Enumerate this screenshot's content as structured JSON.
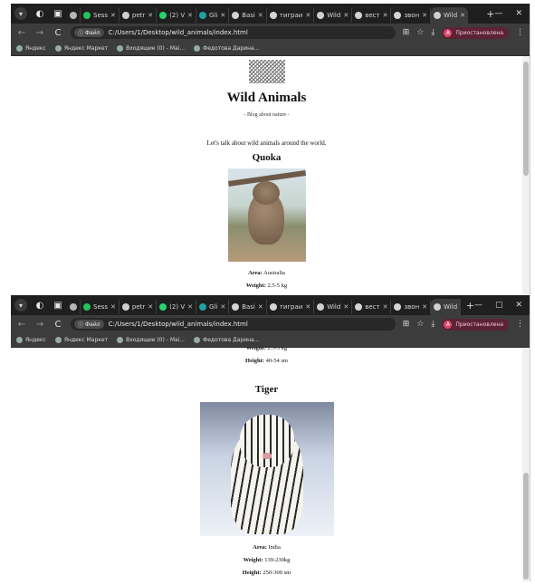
{
  "browser": {
    "tabs_top": [
      {
        "label": "",
        "color": "#b6b6b6"
      },
      {
        "label": "Sess",
        "color": "#25c35b"
      },
      {
        "label": "petr",
        "color": "#cfcfcf"
      },
      {
        "label": "(2) V",
        "color": "#2bd36a"
      },
      {
        "label": "Gli",
        "color": "#21a2a2"
      },
      {
        "label": "Basi",
        "color": "#d4d4d4"
      },
      {
        "label": "тиграи",
        "color": "#d4d4d4"
      },
      {
        "label": "Wild",
        "color": "#cfcfcf"
      },
      {
        "label": "вест",
        "color": "#d4d4d4"
      },
      {
        "label": "звон",
        "color": "#d4d4d4"
      },
      {
        "label": "Wild",
        "color": "#cfcfcf",
        "active": true
      }
    ],
    "tabs_bottom": [
      {
        "label": "",
        "color": "#b6b6b6"
      },
      {
        "label": "Sess",
        "color": "#25c35b"
      },
      {
        "label": "petr",
        "color": "#cfcfcf"
      },
      {
        "label": "(2) V",
        "color": "#2bd36a"
      },
      {
        "label": "Gli",
        "color": "#21a2a2"
      },
      {
        "label": "Basi",
        "color": "#d4d4d4"
      },
      {
        "label": "тиграи",
        "color": "#d4d4d4"
      },
      {
        "label": "Wild",
        "color": "#cfcfcf"
      },
      {
        "label": "вест",
        "color": "#d4d4d4"
      },
      {
        "label": "звон",
        "color": "#d4d4d4"
      },
      {
        "label": "Wild",
        "color": "#cfcfcf",
        "active": true
      }
    ],
    "file_chip": "Файл",
    "url": "C:/Users/1/Desktop/wild_animals/index.html",
    "profile_status": "Приостановлена",
    "avatar_letter": "А",
    "bookmarks": [
      "Яндекс",
      "Яндекс Маркет",
      "Входящие (0) - Mai...",
      "Федотова Дарина..."
    ]
  },
  "site": {
    "title": "Wild Animals",
    "tagline": "- Blog about nature -",
    "intro": "Let's talk about wild animals around the world.",
    "labels": {
      "area": "Area:",
      "weight": "Weight:",
      "height": "Height:"
    },
    "animals": [
      {
        "name": "Quoka",
        "area": "Australia",
        "weight": "2.5-5 kg",
        "height": "40-54 sm"
      },
      {
        "name": "Tiger",
        "area": "India",
        "weight": "139-230kg",
        "height": "250-300 sm"
      }
    ]
  }
}
